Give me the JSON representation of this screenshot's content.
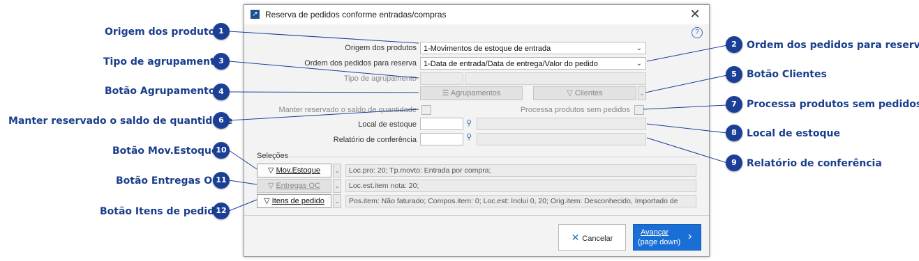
{
  "dialog": {
    "title": "Reserva de pedidos conforme entradas/compras",
    "close_glyph": "✕",
    "help_glyph": "?"
  },
  "form": {
    "origem_label": "Origem dos produtos",
    "origem_value": "1-Movimentos de estoque de entrada",
    "ordem_label": "Ordem dos pedidos para reserva",
    "ordem_value": "1-Data de entrada/Data de entrega/Valor do pedido",
    "tipo_label": "Tipo de agrupamento",
    "agrup_button": "Agrupamentos",
    "clientes_button": "Clientes",
    "manter_label": "Manter reservado o saldo de quantidade",
    "processa_label": "Processa produtos sem pedidos",
    "local_label": "Local de estoque",
    "relatorio_label": "Relatório de conferência"
  },
  "selecoes": {
    "title": "Seleções",
    "rows": [
      {
        "button": "Mov.Estoque",
        "info": "Loc.pro: 20; Tp.movto: Entrada por compra;"
      },
      {
        "button": "Entregas OC",
        "info": "Loc.est.item nota: 20;"
      },
      {
        "button": "Itens de pedido",
        "info": "Pos.item: Não faturado; Compos.item: 0; Loc.est: Inclui 0, 20; Orig.item: Desconhecido, Importado de"
      }
    ]
  },
  "footer": {
    "cancel": "Cancelar",
    "next_line1": "Avançar",
    "next_line2": "(page down)"
  },
  "callouts": [
    {
      "num": "1",
      "text": "Origem dos produtos"
    },
    {
      "num": "2",
      "text": "Ordem dos pedidos para reserva"
    },
    {
      "num": "3",
      "text": "Tipo de agrupamento"
    },
    {
      "num": "4",
      "text": "Botão Agrupamentos"
    },
    {
      "num": "5",
      "text": "Botão Clientes"
    },
    {
      "num": "6",
      "text": "Manter reservado o saldo de quantidade"
    },
    {
      "num": "7",
      "text": "Processa produtos sem pedidos"
    },
    {
      "num": "8",
      "text": "Local de estoque"
    },
    {
      "num": "9",
      "text": "Relatório de conferência"
    },
    {
      "num": "10",
      "text": "Botão Mov.Estoque"
    },
    {
      "num": "11",
      "text": "Botão Entregas OC"
    },
    {
      "num": "12",
      "text": "Botão Itens de pedido"
    }
  ],
  "colors": {
    "callout": "#1b3f96",
    "primary": "#1a6fd6"
  }
}
